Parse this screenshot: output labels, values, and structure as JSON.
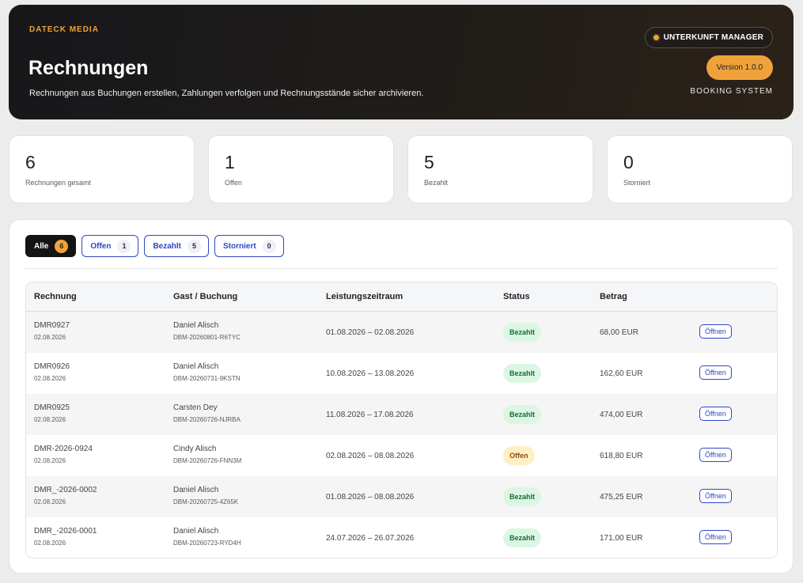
{
  "header": {
    "brand": "DATECK MEDIA",
    "title": "Rechnungen",
    "subtitle": "Rechnungen aus Buchungen erstellen, Zahlungen verfolgen und Rechnungsstände sicher archivieren.",
    "manager_label": "UNTERKUNFT MANAGER",
    "version_label": "Version 1.0.0",
    "system_label": "BOOKING SYSTEM"
  },
  "stats": [
    {
      "value": "6",
      "label": "Rechnungen gesamt"
    },
    {
      "value": "1",
      "label": "Offen"
    },
    {
      "value": "5",
      "label": "Bezahlt"
    },
    {
      "value": "0",
      "label": "Storniert"
    }
  ],
  "filters": [
    {
      "label": "Alle",
      "count": "6",
      "active": true
    },
    {
      "label": "Offen",
      "count": "1",
      "active": false
    },
    {
      "label": "Bezahlt",
      "count": "5",
      "active": false
    },
    {
      "label": "Storniert",
      "count": "0",
      "active": false
    }
  ],
  "table": {
    "columns": [
      "Rechnung",
      "Gast / Buchung",
      "Leistungszeitraum",
      "Status",
      "Betrag"
    ],
    "rows": [
      {
        "invoice": "DMR0927",
        "date": "02.08.2026",
        "guest": "Daniel Alisch",
        "booking": "DBM-20260801-R6TYC",
        "period": "01.08.2026 – 02.08.2026",
        "status": "Bezahlt",
        "amount": "68,00 EUR",
        "action": "Öffnen"
      },
      {
        "invoice": "DMR0926",
        "date": "02.08.2026",
        "guest": "Daniel Alisch",
        "booking": "DBM-20260731-9KSTN",
        "period": "10.08.2026 – 13.08.2026",
        "status": "Bezahlt",
        "amount": "162,60 EUR",
        "action": "Öffnen"
      },
      {
        "invoice": "DMR0925",
        "date": "02.08.2026",
        "guest": "Carsten Dey",
        "booking": "DBM-20260726-NJRBA",
        "period": "11.08.2026 – 17.08.2026",
        "status": "Bezahlt",
        "amount": "474,00 EUR",
        "action": "Öffnen"
      },
      {
        "invoice": "DMR-2026-0924",
        "date": "02.08.2026",
        "guest": "Cindy Alisch",
        "booking": "DBM-20260726-FNN3M",
        "period": "02.08.2026 – 08.08.2026",
        "status": "Offen",
        "amount": "618,80 EUR",
        "action": "Öffnen"
      },
      {
        "invoice": "DMR_-2026-0002",
        "date": "02.08.2026",
        "guest": "Daniel Alisch",
        "booking": "DBM-20260725-4Z65K",
        "period": "01.08.2026 – 08.08.2026",
        "status": "Bezahlt",
        "amount": "475,25 EUR",
        "action": "Öffnen"
      },
      {
        "invoice": "DMR_-2026-0001",
        "date": "02.08.2026",
        "guest": "Daniel Alisch",
        "booking": "DBM-20260723-RYD4H",
        "period": "24.07.2026 – 26.07.2026",
        "status": "Bezahlt",
        "amount": "171,00 EUR",
        "action": "Öffnen"
      }
    ]
  },
  "colors": {
    "accent": "#f0a23a",
    "link": "#2f47c4",
    "paid_bg": "#dcf6e4",
    "open_bg": "#fdf0c4"
  }
}
